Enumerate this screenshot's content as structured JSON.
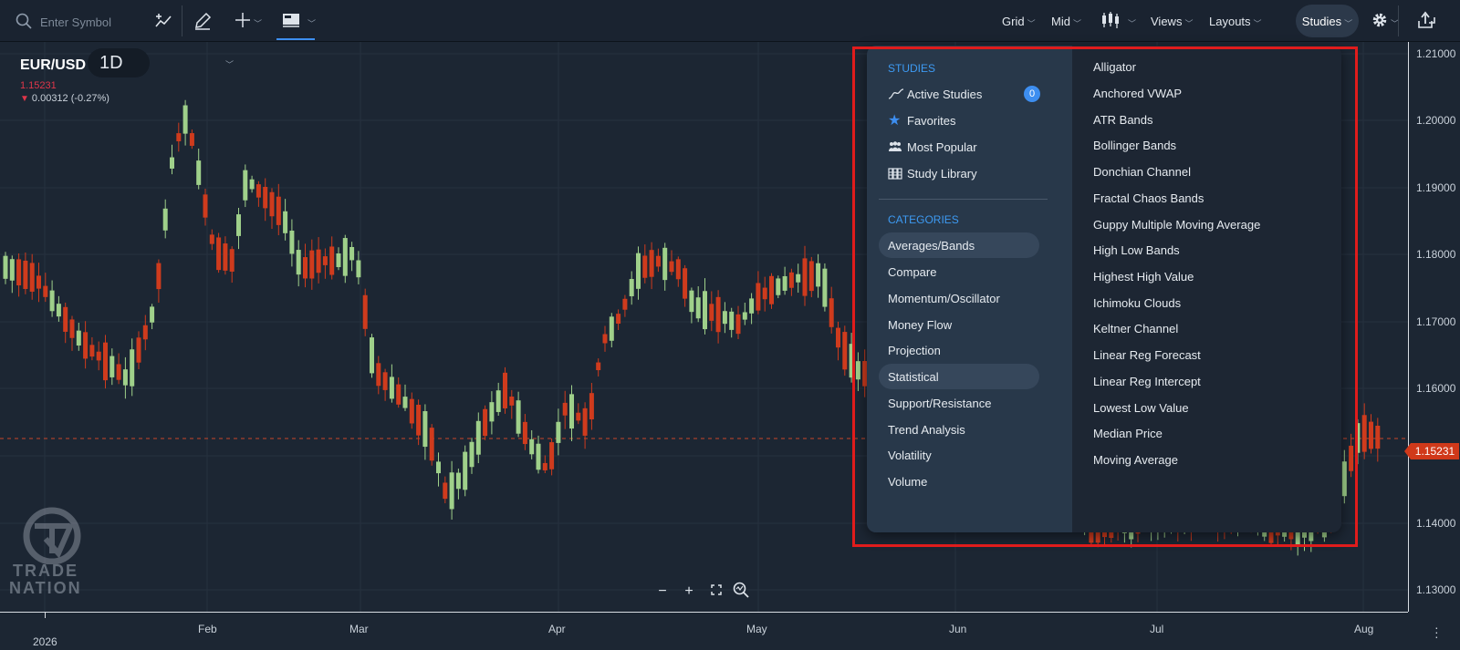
{
  "toolbar": {
    "search_placeholder": "Enter Symbol",
    "grid_label": "Grid",
    "price_type_label": "Mid",
    "views_label": "Views",
    "layouts_label": "Layouts",
    "studies_label": "Studies"
  },
  "chart_header": {
    "symbol": "EUR/USD",
    "interval": "1D",
    "last_price": "1.15231",
    "change": "0.00312 (-0.27%)"
  },
  "price_axis": {
    "ticks": [
      "1.21000",
      "1.20000",
      "1.19000",
      "1.18000",
      "1.17000",
      "1.16000",
      "1.15000",
      "1.14000",
      "1.13000"
    ],
    "current_price": "1.15231"
  },
  "time_axis": {
    "year": "2026",
    "months": [
      "Feb",
      "Mar",
      "Apr",
      "May",
      "Jun",
      "Jul",
      "Aug"
    ]
  },
  "logo": {
    "text_line1": "TRADE",
    "text_line2": "NATION"
  },
  "studies_menu": {
    "studies_heading": "STUDIES",
    "nav": [
      {
        "label": "Active Studies",
        "icon": "line-chart-icon",
        "badge": "0"
      },
      {
        "label": "Favorites",
        "icon": "star-icon"
      },
      {
        "label": "Most Popular",
        "icon": "people-icon"
      },
      {
        "label": "Study Library",
        "icon": "library-icon"
      }
    ],
    "categories_heading": "CATEGORIES",
    "categories": [
      "Averages/Bands",
      "Compare",
      "Momentum/Oscillator",
      "Money Flow",
      "Projection",
      "Statistical",
      "Support/Resistance",
      "Trend Analysis",
      "Volatility",
      "Volume"
    ],
    "studies": [
      "Alligator",
      "Anchored VWAP",
      "ATR Bands",
      "Bollinger Bands",
      "Donchian Channel",
      "Fractal Chaos Bands",
      "Guppy Multiple Moving Average",
      "High Low Bands",
      "Highest High Value",
      "Ichimoku Clouds",
      "Keltner Channel",
      "Linear Reg Forecast",
      "Linear Reg Intercept",
      "Lowest Low Value",
      "Median Price",
      "Moving Average"
    ]
  },
  "colors": {
    "up_candle": "#9fd08a",
    "down_candle": "#cf3b1d",
    "accent": "#3d8ef0",
    "highlight": "#e01c1c"
  }
}
